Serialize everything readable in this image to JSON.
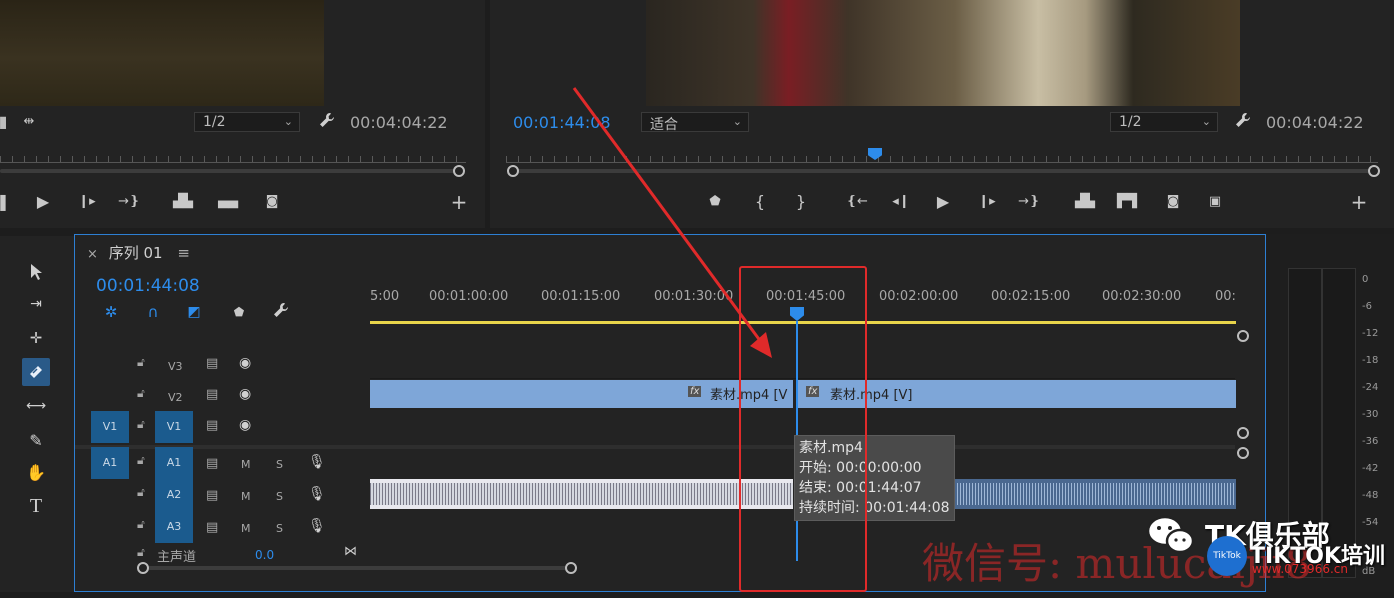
{
  "source_monitor": {
    "scale_label": "1/2",
    "end_timecode": "00:04:04:22"
  },
  "program_monitor": {
    "current_timecode": "00:01:44:08",
    "fit_label": "适合",
    "scale_label": "1/2",
    "end_timecode": "00:04:04:22"
  },
  "timeline": {
    "tab_close": "×",
    "tab_title": "序列 01",
    "tab_menu": "≡",
    "current_timecode": "00:01:44:08",
    "ruler_labels": [
      "5:00",
      "00:01:00:00",
      "00:01:15:00",
      "00:01:30:00",
      "00:01:45:00",
      "00:02:00:00",
      "00:02:15:00",
      "00:02:30:00",
      "00:"
    ],
    "tracks": {
      "v3": "V3",
      "v2": "V2",
      "v1": "V1",
      "v1_source": "V1",
      "a1": "A1",
      "a1_source": "A1",
      "a2": "A2",
      "a3": "A3",
      "m": "M",
      "s": "S"
    },
    "master": {
      "label": "主声道",
      "value": "0.0"
    },
    "clips": {
      "v_left": "素材.mp4 [V",
      "v_right": "素材.mp4 [V]",
      "fx": "fx"
    },
    "tooltip": {
      "name": "素材.mp4",
      "start": "开始: 00:00:00:00",
      "end": "结束: 00:01:44:07",
      "duration": "持续时间: 00:01:44:08"
    }
  },
  "audio_meter": {
    "ticks": [
      "0",
      "-6",
      "-12",
      "-18",
      "-24",
      "-30",
      "-36",
      "-42",
      "-48",
      "-54",
      "dB"
    ]
  },
  "watermark": {
    "brand": "TK俱乐部",
    "wechat": "微信号: mulucaijii8",
    "logo_text": "TikTok",
    "tiktok": "TIKTOK培训",
    "site": "www.073966.cn"
  },
  "colors": {
    "accent_blue": "#2d8ceb",
    "annotation_red": "#e02a2a",
    "clip_video": "#7ea6d8",
    "work_area": "#e8d44a"
  }
}
